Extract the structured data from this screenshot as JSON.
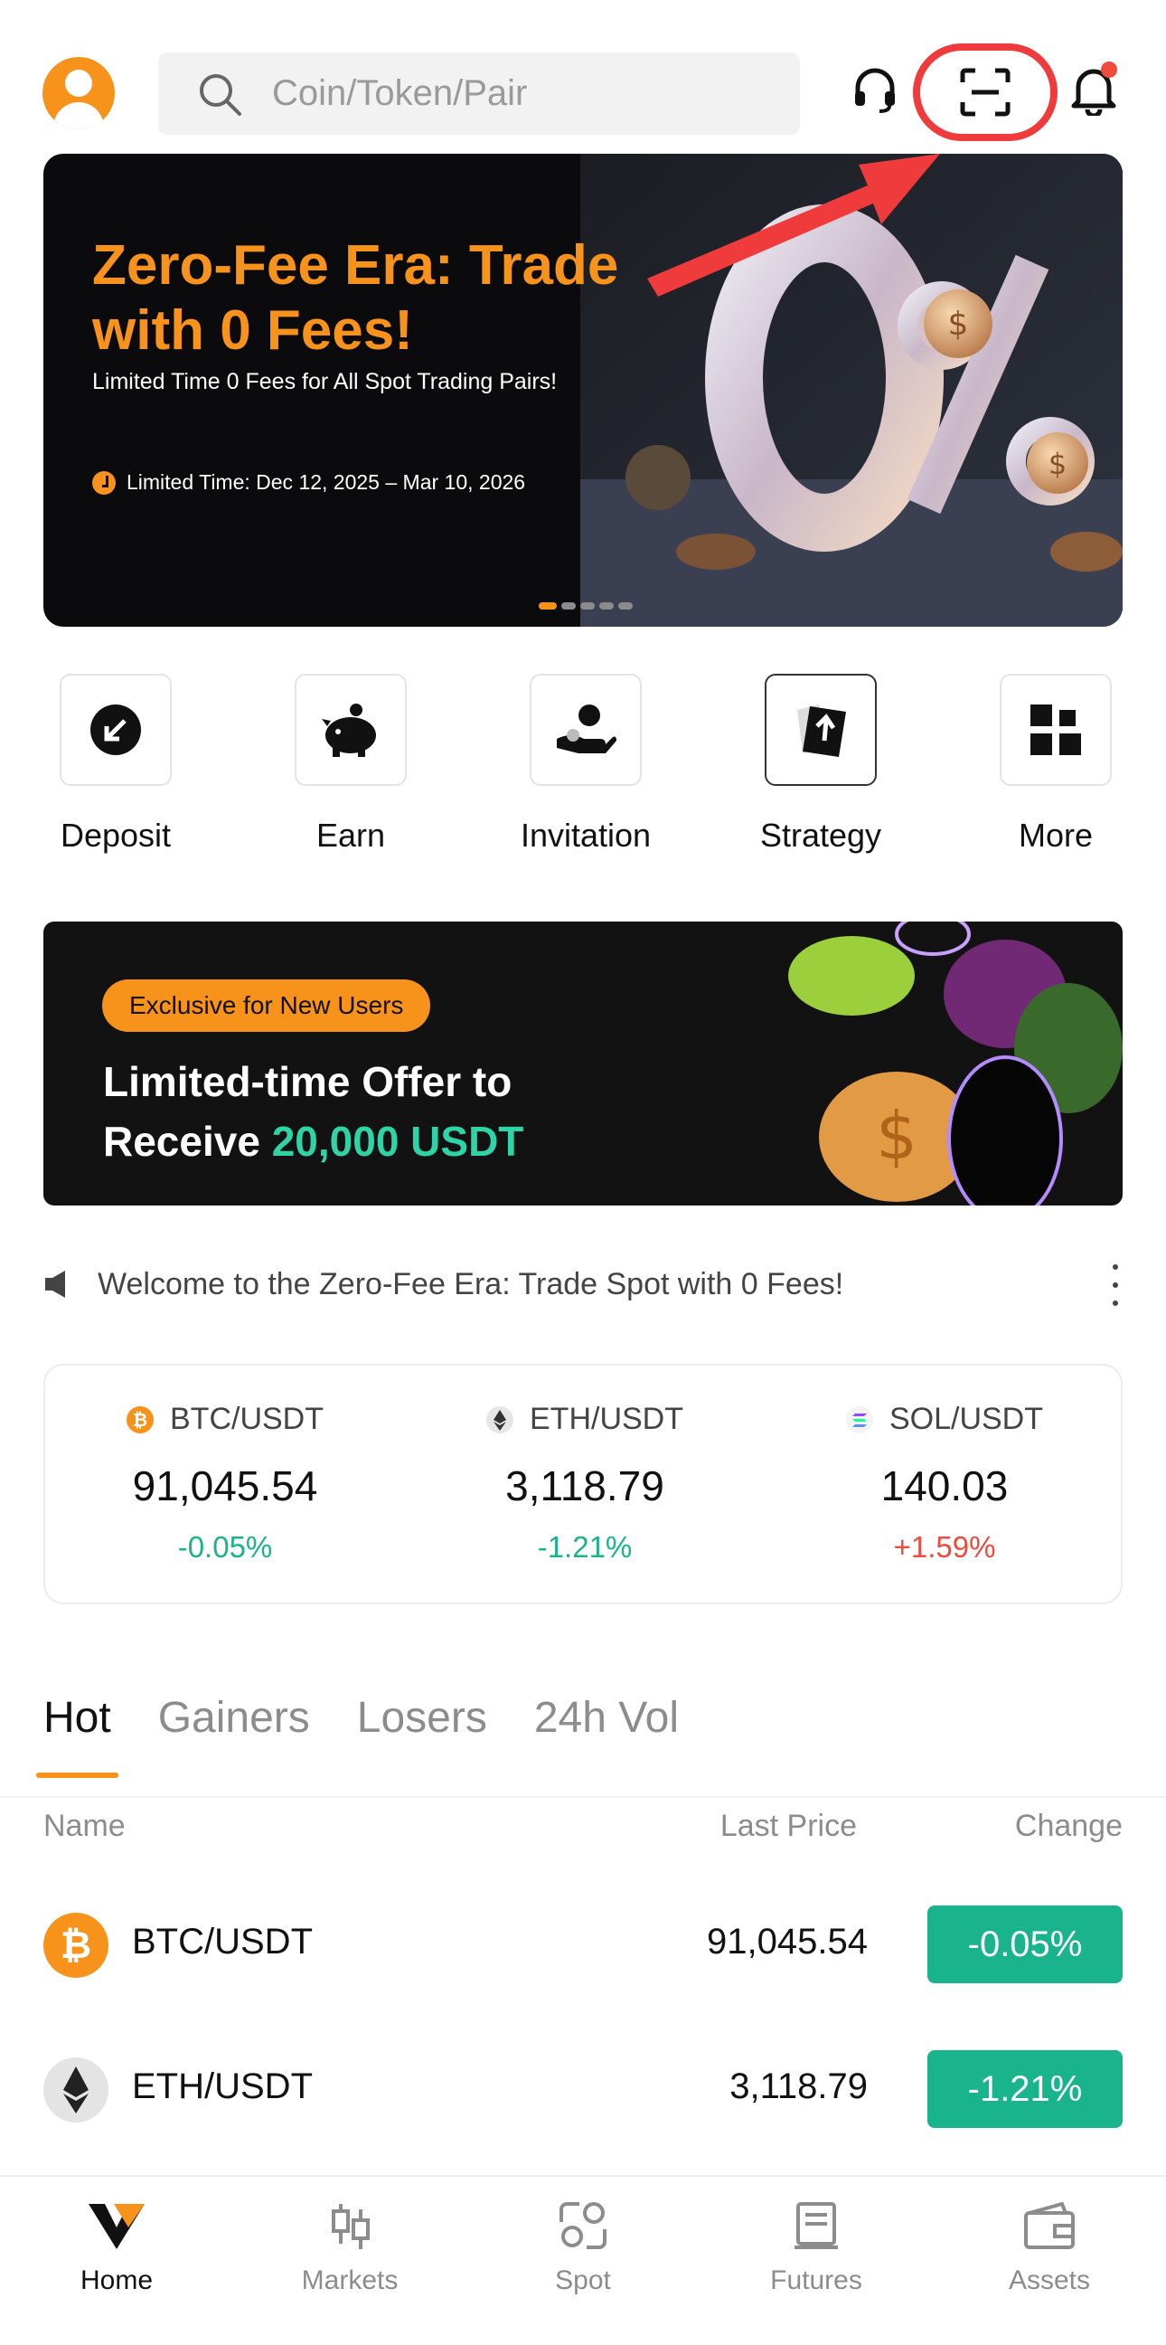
{
  "search": {
    "placeholder": "Coin/Token/Pair"
  },
  "banner": {
    "title": "Zero-Fee Era: Trade with 0 Fees!",
    "subtitle": "Limited Time 0 Fees for All Spot Trading Pairs!",
    "time": "Limited Time: Dec 12, 2025 – Mar 10, 2026",
    "art_text": "0%",
    "slide_count": 5,
    "active_slide": 1
  },
  "actions": [
    {
      "label": "Deposit",
      "icon": "deposit-icon"
    },
    {
      "label": "Earn",
      "icon": "piggy-bank-icon"
    },
    {
      "label": "Invitation",
      "icon": "invite-icon"
    },
    {
      "label": "Strategy",
      "icon": "strategy-icon"
    },
    {
      "label": "More",
      "icon": "grid-icon"
    }
  ],
  "promo": {
    "tag": "Exclusive for New Users",
    "line1": "Limited-time Offer to",
    "line2_prefix": "Receive ",
    "line2_accent": "20,000 USDT"
  },
  "announcement": {
    "text": "Welcome to the Zero-Fee Era: Trade Spot with 0 Fees!"
  },
  "tickers": [
    {
      "pair": "BTC/USDT",
      "price": "91,045.54",
      "change": "-0.05%",
      "direction": "down"
    },
    {
      "pair": "ETH/USDT",
      "price": "3,118.79",
      "change": "-1.21%",
      "direction": "down"
    },
    {
      "pair": "SOL/USDT",
      "price": "140.03",
      "change": "+1.59%",
      "direction": "up"
    }
  ],
  "market": {
    "tabs": [
      "Hot",
      "Gainers",
      "Losers",
      "24h Vol"
    ],
    "active_tab": "Hot",
    "columns": {
      "name": "Name",
      "last_price": "Last Price",
      "change": "Change"
    },
    "rows": [
      {
        "pair": "BTC/USDT",
        "price": "91,045.54",
        "change": "-0.05%"
      },
      {
        "pair": "ETH/USDT",
        "price": "3,118.79",
        "change": "-1.21%"
      }
    ]
  },
  "nav": [
    {
      "label": "Home",
      "active": true
    },
    {
      "label": "Markets",
      "active": false
    },
    {
      "label": "Spot",
      "active": false
    },
    {
      "label": "Futures",
      "active": false
    },
    {
      "label": "Assets",
      "active": false
    }
  ],
  "colors": {
    "brand": "#f7931a",
    "down": "#19b48b",
    "up": "#ef4a3c",
    "annotation": "#ef3b3b",
    "promo_accent": "#2fd4a6"
  }
}
